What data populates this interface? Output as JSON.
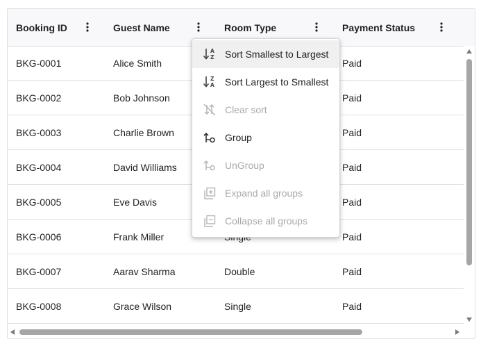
{
  "columns": [
    {
      "label": "Booking ID"
    },
    {
      "label": "Guest Name"
    },
    {
      "label": "Room Type"
    },
    {
      "label": "Payment Status"
    }
  ],
  "rows": [
    {
      "id": "BKG-0001",
      "guest": "Alice Smith",
      "room": "",
      "payment": "Paid"
    },
    {
      "id": "BKG-0002",
      "guest": "Bob Johnson",
      "room": "",
      "payment": "Paid"
    },
    {
      "id": "BKG-0003",
      "guest": "Charlie Brown",
      "room": "",
      "payment": "Paid"
    },
    {
      "id": "BKG-0004",
      "guest": "David Williams",
      "room": "",
      "payment": "Paid"
    },
    {
      "id": "BKG-0005",
      "guest": "Eve Davis",
      "room": "",
      "payment": "Paid"
    },
    {
      "id": "BKG-0006",
      "guest": "Frank Miller",
      "room": "Single",
      "payment": "Paid"
    },
    {
      "id": "BKG-0007",
      "guest": "Aarav Sharma",
      "room": "Double",
      "payment": "Paid"
    },
    {
      "id": "BKG-0008",
      "guest": "Grace Wilson",
      "room": "Single",
      "payment": "Paid"
    }
  ],
  "column_menu": {
    "items": [
      {
        "label": "Sort Smallest to Largest",
        "icon": "sort-ascending-icon",
        "enabled": true,
        "hovered": true
      },
      {
        "label": "Sort Largest to Smallest",
        "icon": "sort-descending-icon",
        "enabled": true
      },
      {
        "label": "Clear sort",
        "icon": "clear-sort-icon",
        "enabled": false
      },
      {
        "label": "Group",
        "icon": "group-icon",
        "enabled": true
      },
      {
        "label": "UnGroup",
        "icon": "ungroup-icon",
        "enabled": false
      },
      {
        "label": "Expand all groups",
        "icon": "expand-groups-icon",
        "enabled": false
      },
      {
        "label": "Collapse all groups",
        "icon": "collapse-groups-icon",
        "enabled": false
      }
    ]
  },
  "colors": {
    "header_bg": "#f8f8fb",
    "border": "#e0e0e0",
    "text": "#212121",
    "disabled_text": "#a9a9a9",
    "menu_hover": "#f0f0f0"
  }
}
